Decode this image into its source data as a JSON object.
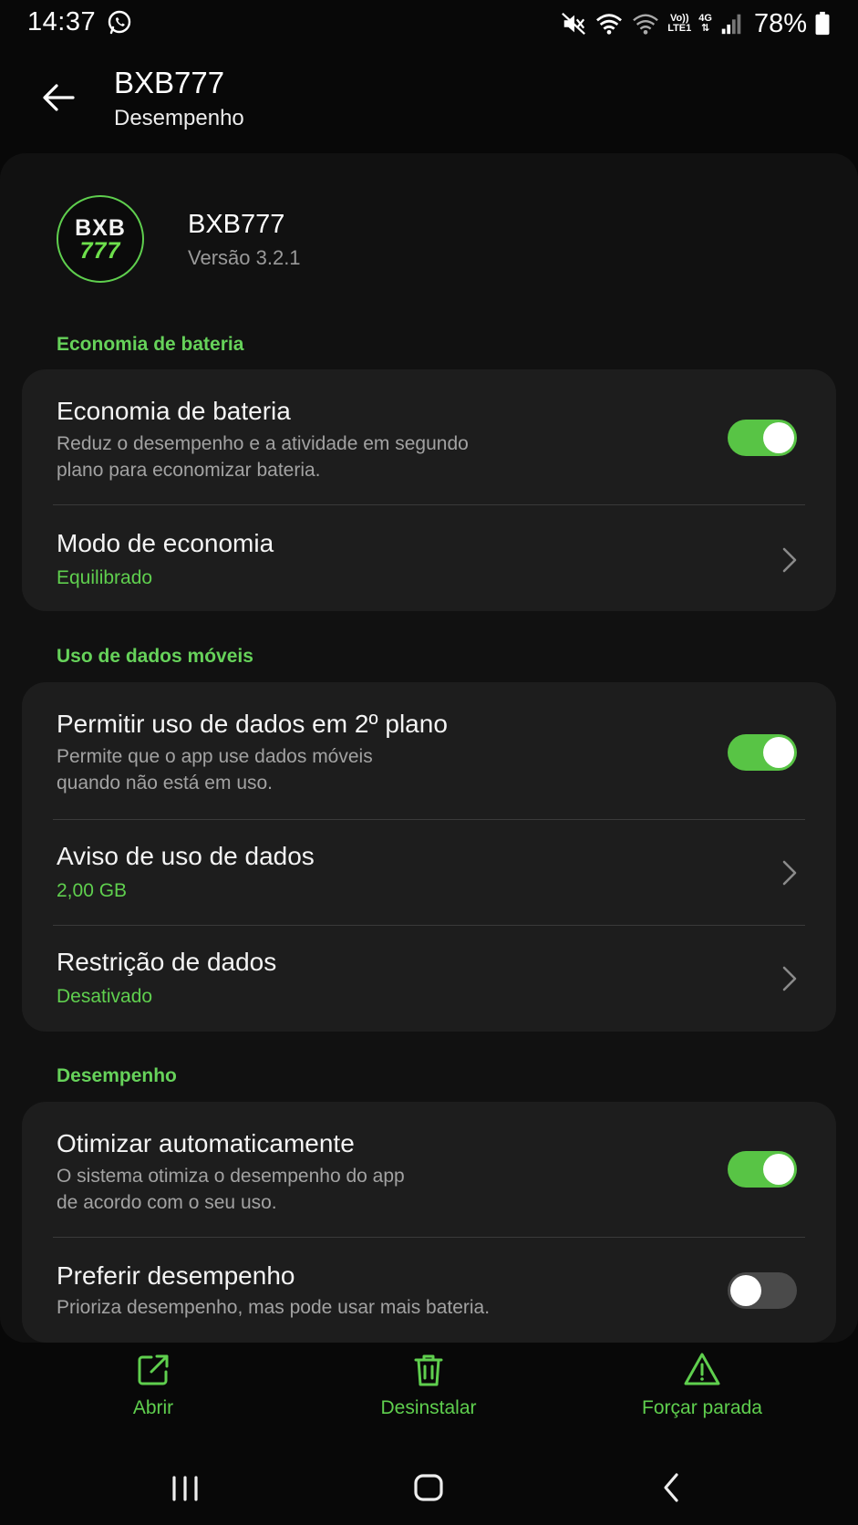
{
  "status_bar": {
    "time": "14:37",
    "network_label_top": "Vo))",
    "network_label_bottom": "LTE1",
    "network_type": "4G",
    "battery": "78%",
    "icons": [
      "whatsapp-icon",
      "mute-icon",
      "wifi-icon",
      "wifi-calling-icon",
      "signal-icon",
      "battery-icon"
    ]
  },
  "header": {
    "title": "BXB777",
    "subtitle": "Desempenho"
  },
  "app": {
    "name": "BXB777",
    "version": "Versão 3.2.1",
    "logo_line1": "BXB",
    "logo_line2": "777"
  },
  "sections": {
    "battery": {
      "label": "Economia de bateria",
      "battery_saver": {
        "title": "Economia de bateria",
        "desc_line1": "Reduz o desempenho e a atividade em segundo",
        "desc_line2": "plano para economizar bateria.",
        "enabled": true
      },
      "saving_mode": {
        "title": "Modo de economia",
        "value": "Equilibrado"
      }
    },
    "mobile_data": {
      "label": "Uso de dados móveis",
      "background_data": {
        "title": "Permitir uso de dados em 2º plano",
        "desc_line1": "Permite que o app use dados móveis",
        "desc_line2": "quando não está em uso.",
        "enabled": true
      },
      "data_warning": {
        "title": "Aviso de uso de dados",
        "value": "2,00 GB"
      },
      "data_restriction": {
        "title": "Restrição de dados",
        "value": "Desativado"
      }
    },
    "performance": {
      "label": "Desempenho",
      "auto_optimize": {
        "title": "Otimizar automaticamente",
        "desc_line1": "O sistema otimiza o desempenho do app",
        "desc_line2": "de acordo com o seu uso.",
        "enabled": true
      },
      "prefer_performance": {
        "title": "Preferir desempenho",
        "desc": "Prioriza desempenho, mas pode usar mais bateria.",
        "enabled": false
      }
    }
  },
  "actions": {
    "open": "Abrir",
    "uninstall": "Desinstalar",
    "force_stop": "Forçar parada"
  },
  "colors": {
    "accent": "#5fcf4e",
    "toggle_on": "#58c445",
    "card": "#1d1d1d",
    "background": "#080808"
  }
}
